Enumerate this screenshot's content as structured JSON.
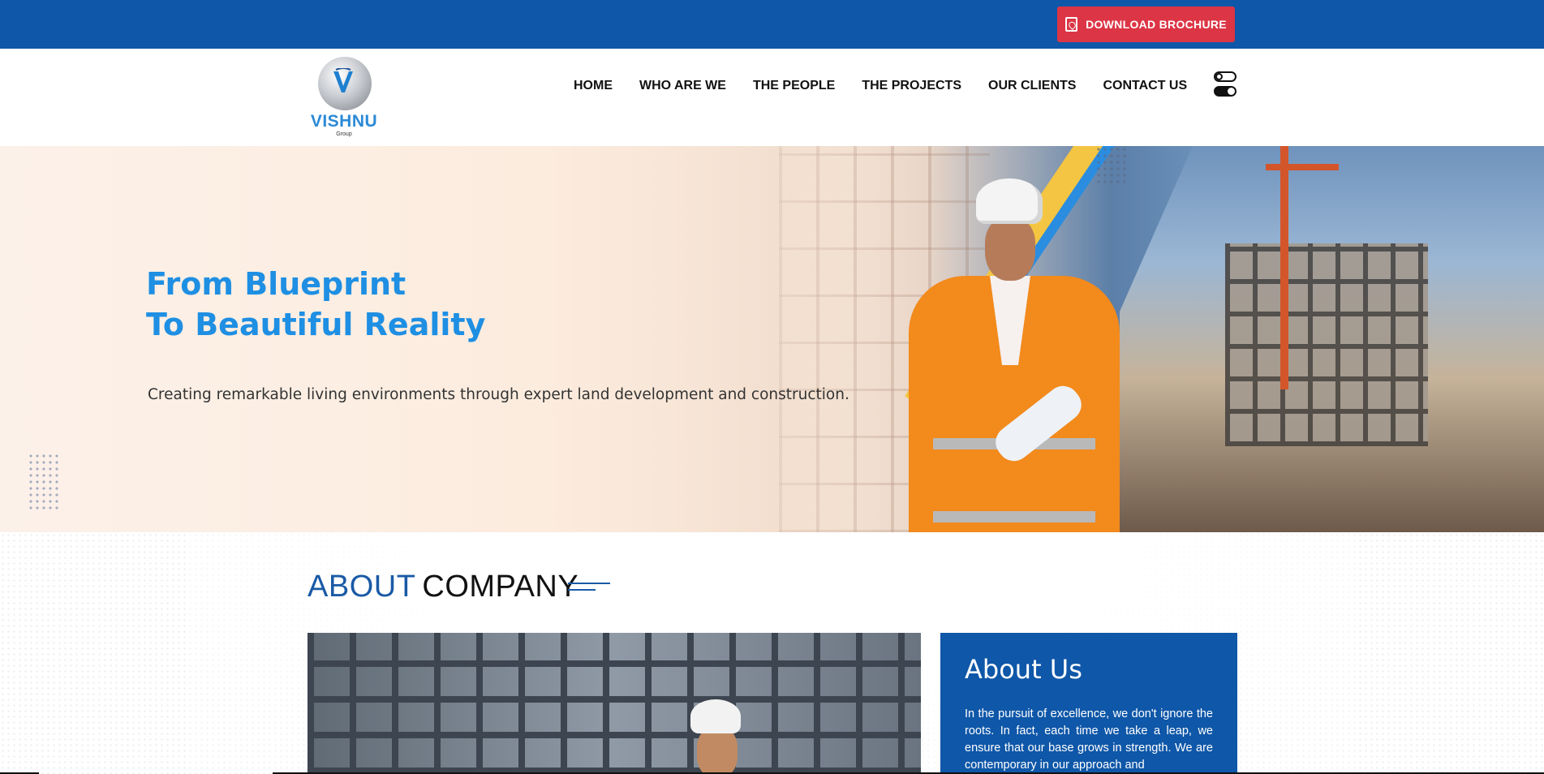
{
  "topbar": {
    "brochure_label": "DOWNLOAD BROCHURE",
    "background": "#0f57a8",
    "button_color": "#dc3545"
  },
  "logo": {
    "name": "VISHNU",
    "subtitle": "Group"
  },
  "nav": {
    "items": [
      "HOME",
      "WHO ARE WE",
      "THE PEOPLE",
      "THE PROJECTS",
      "OUR CLIENTS",
      "CONTACT US"
    ]
  },
  "hero": {
    "title_line1": "From Blueprint",
    "title_line2": "To Beautiful Reality",
    "subtitle": "Creating remarkable living environments through expert land development and construction.",
    "title_color": "#1e8fe3"
  },
  "about": {
    "heading_accent": "ABOUT",
    "heading_rest": "COMPANY",
    "card_title": "About Us",
    "card_text": "In the pursuit of excellence, we don't ignore the roots. In fact, each time we take a leap, we ensure that our base grows in strength. We are contemporary in our approach and"
  },
  "icons": [
    "pdf-icon",
    "theme-toggle-icon"
  ]
}
